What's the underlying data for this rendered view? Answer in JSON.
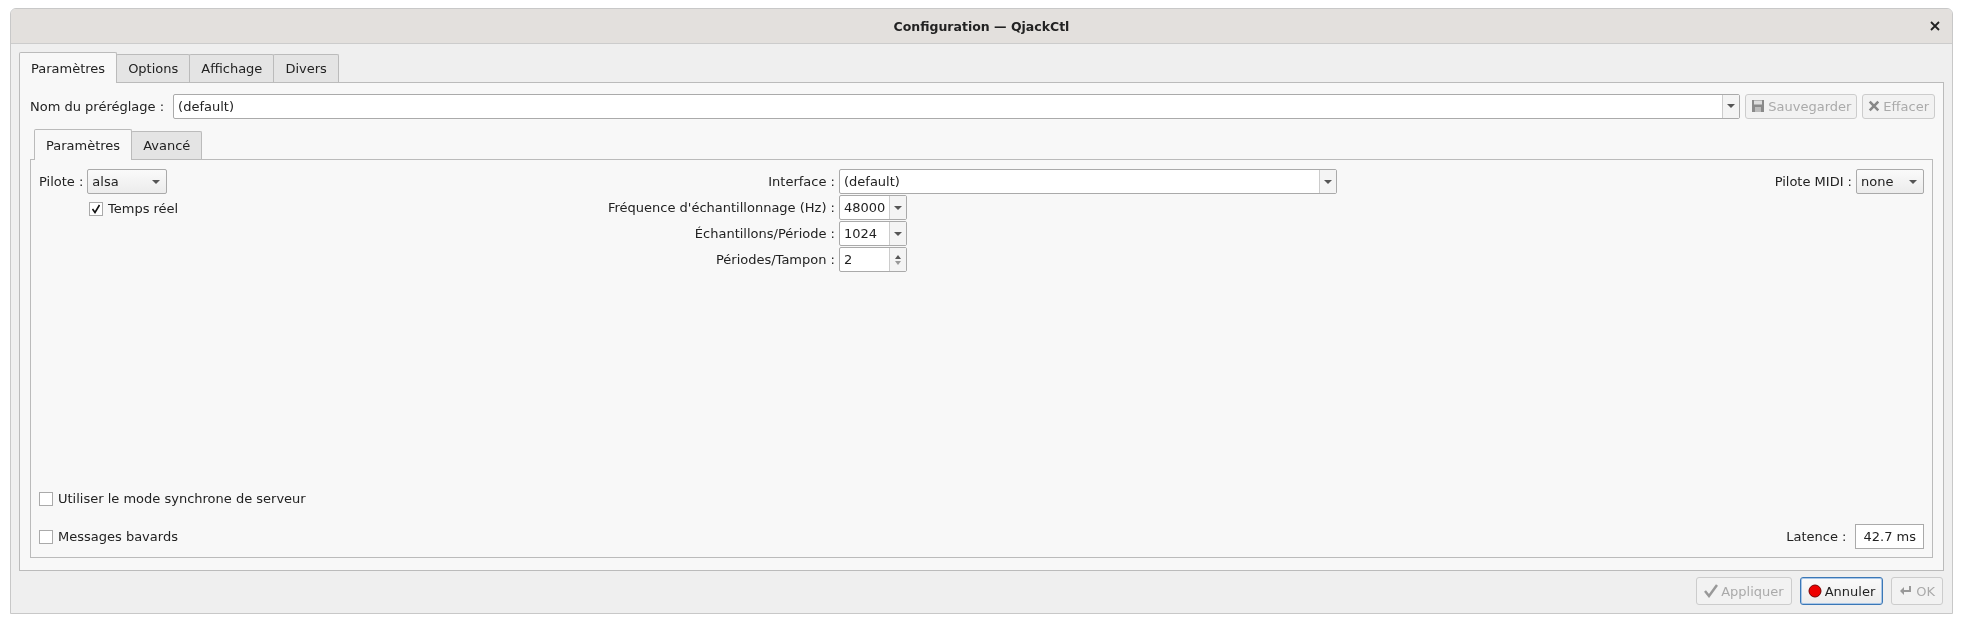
{
  "window": {
    "title": "Configuration — QjackCtl"
  },
  "tabs": [
    {
      "label": "Paramètres",
      "selected": true
    },
    {
      "label": "Options",
      "selected": false
    },
    {
      "label": "Affichage",
      "selected": false
    },
    {
      "label": "Divers",
      "selected": false
    }
  ],
  "preset": {
    "label": "Nom du préréglage :",
    "value": "(default)"
  },
  "preset_buttons": [
    {
      "label": "Sauvegarder",
      "disabled": true
    },
    {
      "label": "Effacer",
      "disabled": true
    }
  ],
  "inner_tabs": [
    {
      "label": "Paramètres",
      "selected": true
    },
    {
      "label": "Avancé",
      "selected": false
    }
  ],
  "driver": {
    "label": "Pilote :",
    "value": "alsa"
  },
  "realtime": {
    "label": "Temps réel",
    "checked": true
  },
  "settings": [
    {
      "kind": "wide-combo",
      "label": "Interface :",
      "value": "(default)"
    },
    {
      "kind": "combo",
      "label": "Fréquence d'échantillonnage (Hz) :",
      "value": "48000"
    },
    {
      "kind": "combo",
      "label": "Échantillons/Période :",
      "value": "1024"
    },
    {
      "kind": "spin",
      "label": "Périodes/Tampon :",
      "value": "2"
    }
  ],
  "midi_driver": {
    "label": "Pilote MIDI :",
    "value": "none"
  },
  "options": [
    {
      "label": "Utiliser le mode synchrone de serveur",
      "checked": false
    },
    {
      "label": "Messages bavards",
      "checked": false
    }
  ],
  "latency": {
    "label": "Latence :",
    "value": "42.7 ms"
  },
  "dialog_buttons": [
    {
      "label": "Appliquer",
      "disabled": true,
      "focused": false
    },
    {
      "label": "Annuler",
      "disabled": false,
      "focused": true
    },
    {
      "label": "OK",
      "disabled": true,
      "focused": false
    }
  ]
}
